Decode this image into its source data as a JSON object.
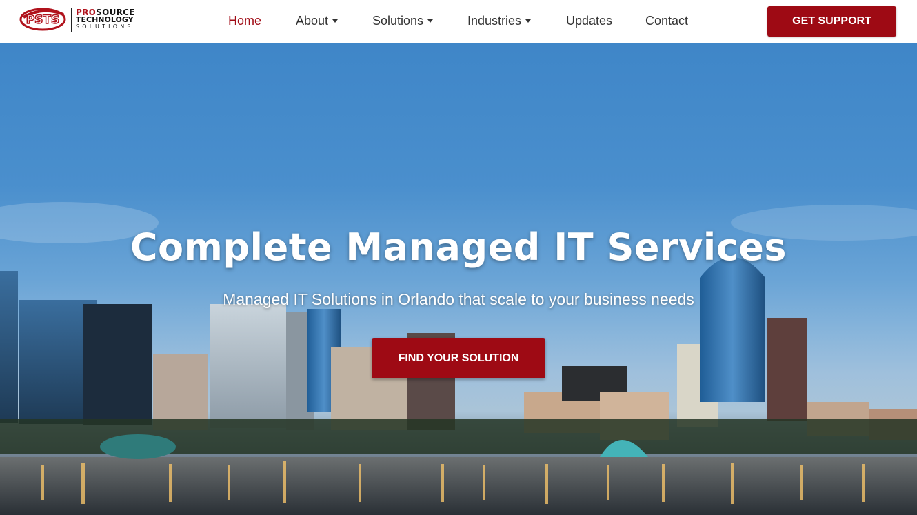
{
  "header": {
    "logo": {
      "mark_text": "PSTS",
      "line1_pro": "PRO",
      "line1_rest": "SOURCE",
      "line2": "TECHNOLOGY",
      "line3": "SOLUTIONS"
    },
    "nav": [
      {
        "label": "Home",
        "active": true,
        "dropdown": false
      },
      {
        "label": "About",
        "active": false,
        "dropdown": true
      },
      {
        "label": "Solutions",
        "active": false,
        "dropdown": true
      },
      {
        "label": "Industries",
        "active": false,
        "dropdown": true
      },
      {
        "label": "Updates",
        "active": false,
        "dropdown": false
      },
      {
        "label": "Contact",
        "active": false,
        "dropdown": false
      }
    ],
    "support_button": "GET SUPPORT"
  },
  "hero": {
    "title": "Complete Managed IT Services",
    "subtitle": "Managed IT Solutions in Orlando that scale to your business needs",
    "cta": "FIND YOUR SOLUTION",
    "background": "city-skyline-image"
  },
  "colors": {
    "brand_red": "#9e0a14",
    "active_nav": "#a10d17",
    "nav_text": "#333333",
    "sky": "#4a8fcd"
  }
}
